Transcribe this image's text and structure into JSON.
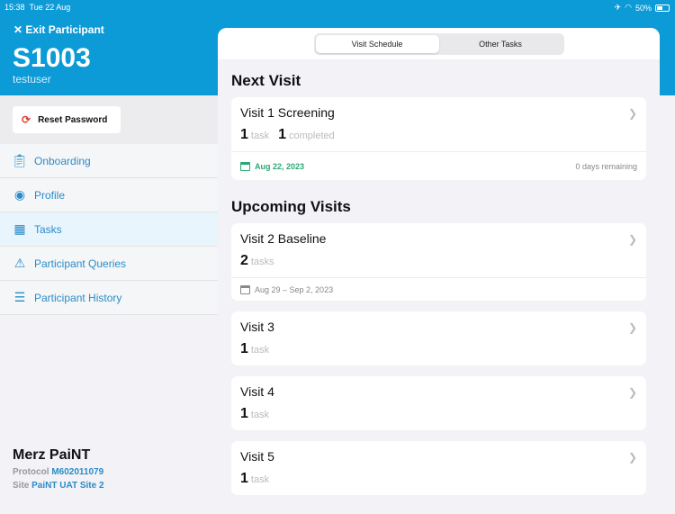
{
  "status": {
    "time": "15:38",
    "date": "Tue 22 Aug",
    "battery": "50%"
  },
  "header": {
    "exit_label": "Exit Participant",
    "participant_id": "S1003",
    "username": "testuser"
  },
  "sidebar": {
    "reset_password": "Reset Password",
    "items": [
      {
        "label": "Onboarding"
      },
      {
        "label": "Profile"
      },
      {
        "label": "Tasks"
      },
      {
        "label": "Participant Queries"
      },
      {
        "label": "Participant History"
      }
    ]
  },
  "footer": {
    "study": "Merz PaiNT",
    "protocol_label": "Protocol",
    "protocol": "M602011079",
    "site_label": "Site",
    "site": "PaiNT UAT Site 2"
  },
  "tabs": [
    "Visit Schedule",
    "Other Tasks"
  ],
  "next": {
    "heading": "Next Visit",
    "title": "Visit 1 Screening",
    "tasks": "1",
    "tasks_label": "task",
    "completed": "1",
    "completed_label": "completed",
    "date": "Aug 22, 2023",
    "remaining": "0 days remaining"
  },
  "upcoming": {
    "heading": "Upcoming Visits",
    "visits": [
      {
        "title": "Visit 2 Baseline",
        "count": "2",
        "label": "tasks",
        "date": "Aug 29 – Sep 2, 2023"
      },
      {
        "title": "Visit 3",
        "count": "1",
        "label": "task"
      },
      {
        "title": "Visit 4",
        "count": "1",
        "label": "task"
      },
      {
        "title": "Visit 5",
        "count": "1",
        "label": "task"
      }
    ]
  }
}
